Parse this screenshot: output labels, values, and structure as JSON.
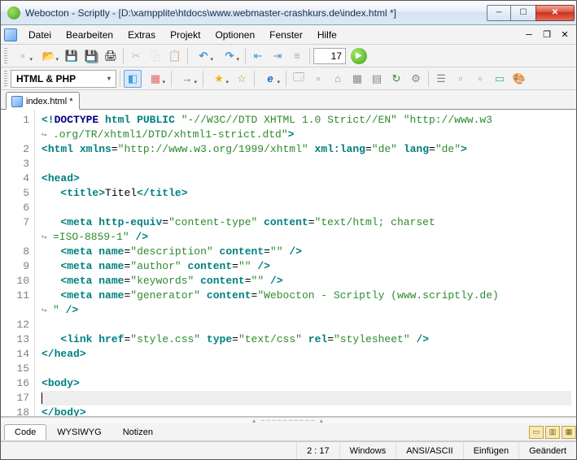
{
  "window": {
    "title": "Webocton - Scriptly - [D:\\xampplite\\htdocs\\www.webmaster-crashkurs.de\\index.html *]"
  },
  "menu": {
    "items": [
      "Datei",
      "Bearbeiten",
      "Extras",
      "Projekt",
      "Optionen",
      "Fenster",
      "Hilfe"
    ]
  },
  "toolbar1": {
    "line_number": "17"
  },
  "toolbar2": {
    "language": "HTML & PHP"
  },
  "tabs": {
    "open": [
      {
        "label": "index.html *"
      }
    ]
  },
  "editor": {
    "gutter": [
      "1",
      "",
      "2",
      "3",
      "4",
      "5",
      "6",
      "7",
      "",
      "8",
      "9",
      "10",
      "11",
      "",
      "12",
      "13",
      "14",
      "15",
      "16",
      "17",
      "18"
    ],
    "lines": [
      {
        "n": 1,
        "html": "<span class='c-brk'>&lt;!</span><span class='c-doc'>DOCTYPE</span> <span class='c-attr'>html</span> <span class='c-attr'>PUBLIC</span> <span class='c-str'>\"-//W3C//DTD XHTML 1.0 Strict//EN\"</span> <span class='c-str'>\"http://www.w3</span>"
      },
      {
        "wrap": true,
        "html": "<span class='c-str'>.org/TR/xhtml1/DTD/xhtml1-strict.dtd\"</span><span class='c-brk'>&gt;</span>"
      },
      {
        "n": 2,
        "html": "<span class='c-brk'>&lt;</span><span class='c-tag'>html</span> <span class='c-attr'>xmlns</span>=<span class='c-str'>\"http://www.w3.org/1999/xhtml\"</span> <span class='c-attr'>xml:lang</span>=<span class='c-str'>\"de\"</span> <span class='c-attr'>lang</span>=<span class='c-str'>\"de\"</span><span class='c-brk'>&gt;</span>"
      },
      {
        "n": 3,
        "html": ""
      },
      {
        "n": 4,
        "html": "<span class='c-brk'>&lt;</span><span class='c-tag'>head</span><span class='c-brk'>&gt;</span>"
      },
      {
        "n": 5,
        "html": "   <span class='c-brk'>&lt;</span><span class='c-tag'>title</span><span class='c-brk'>&gt;</span><span class='c-text'>Titel</span><span class='c-brk'>&lt;/</span><span class='c-tag'>title</span><span class='c-brk'>&gt;</span>"
      },
      {
        "n": 6,
        "html": ""
      },
      {
        "n": 7,
        "html": "   <span class='c-brk'>&lt;</span><span class='c-tag'>meta</span> <span class='c-attr'>http-equiv</span>=<span class='c-str'>\"content-type\"</span> <span class='c-attr'>content</span>=<span class='c-str'>\"text/html; charset</span>"
      },
      {
        "wrap": true,
        "html": "<span class='c-str'>=ISO-8859-1\"</span> <span class='c-brk'>/&gt;</span>"
      },
      {
        "n": 8,
        "html": "   <span class='c-brk'>&lt;</span><span class='c-tag'>meta</span> <span class='c-attr'>name</span>=<span class='c-str'>\"description\"</span> <span class='c-attr'>content</span>=<span class='c-str'>\"\"</span> <span class='c-brk'>/&gt;</span>"
      },
      {
        "n": 9,
        "html": "   <span class='c-brk'>&lt;</span><span class='c-tag'>meta</span> <span class='c-attr'>name</span>=<span class='c-str'>\"author\"</span> <span class='c-attr'>content</span>=<span class='c-str'>\"\"</span> <span class='c-brk'>/&gt;</span>"
      },
      {
        "n": 10,
        "html": "   <span class='c-brk'>&lt;</span><span class='c-tag'>meta</span> <span class='c-attr'>name</span>=<span class='c-str'>\"keywords\"</span> <span class='c-attr'>content</span>=<span class='c-str'>\"\"</span> <span class='c-brk'>/&gt;</span>"
      },
      {
        "n": 11,
        "html": "   <span class='c-brk'>&lt;</span><span class='c-tag'>meta</span> <span class='c-attr'>name</span>=<span class='c-str'>\"generator\"</span> <span class='c-attr'>content</span>=<span class='c-str'>\"Webocton - Scriptly (www.scriptly.de)</span>"
      },
      {
        "wrap": true,
        "html": "<span class='c-str'>\"</span> <span class='c-brk'>/&gt;</span>"
      },
      {
        "n": 12,
        "html": ""
      },
      {
        "n": 13,
        "html": "   <span class='c-brk'>&lt;</span><span class='c-tag'>link</span> <span class='c-attr'>href</span>=<span class='c-str'>\"style.css\"</span> <span class='c-attr'>type</span>=<span class='c-str'>\"text/css\"</span> <span class='c-attr'>rel</span>=<span class='c-str'>\"stylesheet\"</span> <span class='c-brk'>/&gt;</span>"
      },
      {
        "n": 14,
        "html": "<span class='c-brk'>&lt;/</span><span class='c-tag'>head</span><span class='c-brk'>&gt;</span>"
      },
      {
        "n": 15,
        "html": ""
      },
      {
        "n": 16,
        "html": "<span class='c-brk'>&lt;</span><span class='c-tag'>body</span><span class='c-brk'>&gt;</span>"
      },
      {
        "n": 17,
        "current": true,
        "html": "<span class='cursor'></span>"
      },
      {
        "n": 18,
        "html": "<span class='c-brk'>&lt;/</span><span class='c-tag'>body</span><span class='c-brk'>&gt;</span>"
      }
    ]
  },
  "bottom_tabs": {
    "items": [
      "Code",
      "WYSIWYG",
      "Notizen"
    ],
    "active": 0
  },
  "status": {
    "position": "2 : 17",
    "platform": "Windows",
    "encoding": "ANSI/ASCII",
    "insert_mode": "Einfügen",
    "modified": "Geändert"
  }
}
